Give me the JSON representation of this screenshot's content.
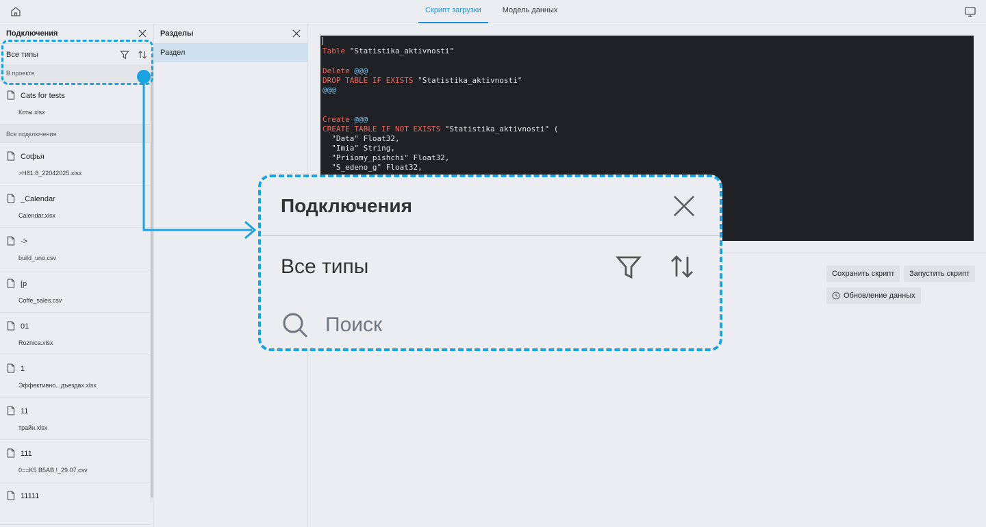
{
  "header": {
    "tabs": [
      {
        "label": "Скрипт загрузки",
        "active": true
      },
      {
        "label": "Модель данных",
        "active": false
      }
    ],
    "accent_color": "#1a8fd6"
  },
  "connections_panel": {
    "title": "Подключения",
    "type_filter": "Все типы",
    "search_placeholder": "Поиск",
    "groups": [
      {
        "label": "В проекте",
        "items": [
          {
            "name": "Cats for tests",
            "file": "Коты.xlsx"
          }
        ]
      },
      {
        "label": "Все подключения",
        "items": [
          {
            "name": "Софья",
            "file": ">H81:8_22042025.xlsx"
          },
          {
            "name": "_Calendar",
            "file": "Calendar.xlsx"
          },
          {
            "name": "->",
            "file": "build_uno.csv"
          },
          {
            "name": "[p",
            "file": "Coffe_sales.csv"
          },
          {
            "name": "01",
            "file": "Roznica.xlsx"
          },
          {
            "name": "1",
            "file": "Эффективно...дъездах.xlsx"
          },
          {
            "name": "11",
            "file": "трайн.xlsx"
          },
          {
            "name": "111",
            "file": "0==K5 B5AB   !_29.07.csv"
          },
          {
            "name": "11111",
            "file": ""
          }
        ]
      }
    ]
  },
  "sections_panel": {
    "title": "Разделы",
    "items": [
      "Раздел"
    ]
  },
  "editor": {
    "lines": [
      [],
      [
        {
          "t": "Table",
          "c": "kw"
        },
        {
          "t": " \"Statistika_aktivnosti\"",
          "c": ""
        }
      ],
      [],
      [
        {
          "t": "Delete",
          "c": "kw"
        },
        {
          "t": " ",
          "c": ""
        },
        {
          "t": "@@@",
          "c": "at"
        }
      ],
      [
        {
          "t": "DROP TABLE IF EXISTS",
          "c": "kw"
        },
        {
          "t": " \"Statistika_aktivnosti\"",
          "c": ""
        }
      ],
      [
        {
          "t": "@@@",
          "c": "at"
        }
      ],
      [],
      [],
      [
        {
          "t": "Create",
          "c": "kw"
        },
        {
          "t": " ",
          "c": ""
        },
        {
          "t": "@@@",
          "c": "at"
        }
      ],
      [
        {
          "t": "CREATE TABLE IF NOT EXISTS",
          "c": "kw"
        },
        {
          "t": " \"Statistika_aktivnosti\" (",
          "c": ""
        }
      ],
      [
        {
          "t": "  \"Data\" Float32,",
          "c": ""
        }
      ],
      [
        {
          "t": "  \"Imia\" String,",
          "c": ""
        }
      ],
      [
        {
          "t": "  \"Priiomy_pishchi\" Float32,",
          "c": ""
        }
      ],
      [
        {
          "t": "  \"S_edeno_g\" Float32,",
          "c": ""
        }
      ]
    ],
    "background": "#1f2125",
    "keyword_color": "#ef6a5f",
    "marker_color": "#7fc5ee"
  },
  "actions": {
    "save_script": "Сохранить скрипт",
    "run_script": "Запустить скрипт",
    "update_data": "Обновление данных"
  },
  "zoom_callout": {
    "title": "Подключения",
    "type_filter": "Все типы",
    "search_placeholder": "Поиск",
    "highlight_color": "#1aa3e0"
  },
  "icons": {
    "home": "home-icon",
    "monitor": "monitor-icon",
    "close": "close-icon",
    "filter": "filter-icon",
    "sort": "sort-icon",
    "search": "search-icon",
    "file": "file-icon",
    "clock": "clock-icon"
  }
}
